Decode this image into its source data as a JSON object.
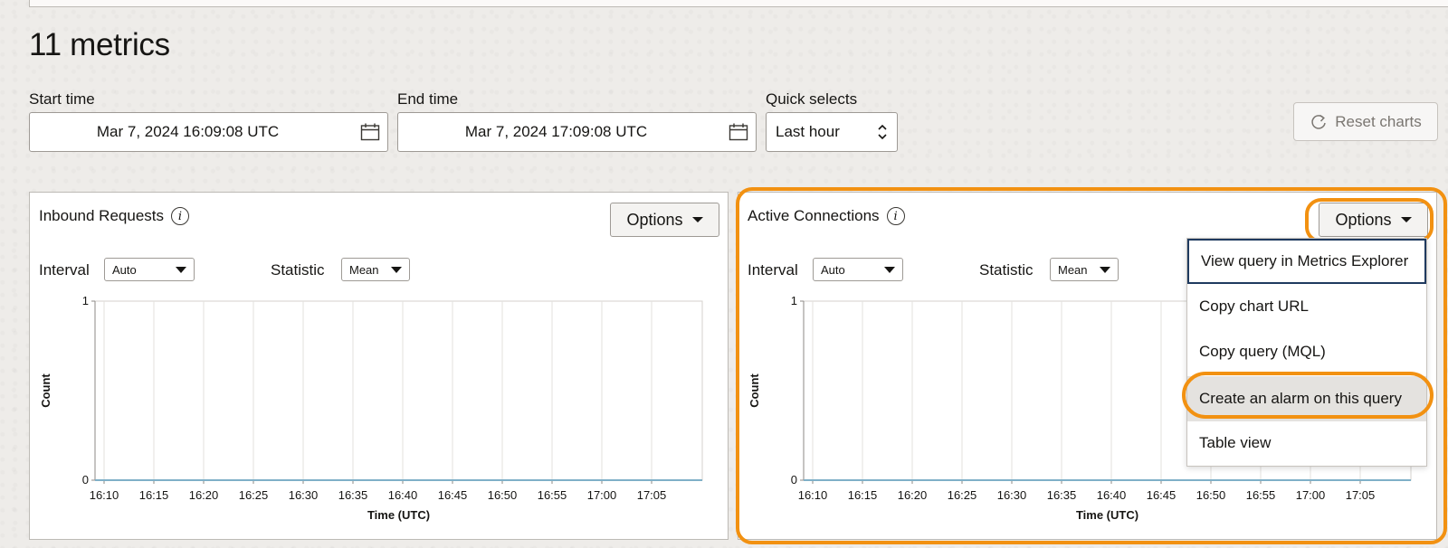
{
  "page": {
    "title": "11 metrics"
  },
  "filters": {
    "start_label": "Start time",
    "start_value": "Mar 7, 2024 16:09:08 UTC",
    "end_label": "End time",
    "end_value": "Mar 7, 2024 17:09:08 UTC",
    "quick_label": "Quick selects",
    "quick_value": "Last hour",
    "reset_label": "Reset charts"
  },
  "charts": [
    {
      "title": "Inbound Requests",
      "options_label": "Options",
      "interval_label": "Interval",
      "interval_value": "Auto",
      "statistic_label": "Statistic",
      "statistic_value": "Mean"
    },
    {
      "title": "Active Connections",
      "options_label": "Options",
      "interval_label": "Interval",
      "interval_value": "Auto",
      "statistic_label": "Statistic",
      "statistic_value": "Mean"
    }
  ],
  "options_menu": {
    "items": [
      "View query in Metrics Explorer",
      "Copy chart URL",
      "Copy query (MQL)",
      "Create an alarm on this query",
      "Table view"
    ]
  },
  "colors": {
    "highlight": "#f29111",
    "series_line": "#7fb0c8",
    "focus": "#1f3a5f"
  },
  "chart_data": [
    {
      "type": "line",
      "title": "Inbound Requests",
      "xlabel": "Time (UTC)",
      "ylabel": "Count",
      "x": [
        "16:10",
        "16:15",
        "16:20",
        "16:25",
        "16:30",
        "16:35",
        "16:40",
        "16:45",
        "16:50",
        "16:55",
        "17:00",
        "17:05"
      ],
      "ylim": [
        0,
        1
      ],
      "yticks": [
        "0",
        "1"
      ],
      "series": [
        {
          "values": [
            0,
            0,
            0,
            0,
            0,
            0,
            0,
            0,
            0,
            0,
            0,
            0
          ]
        }
      ],
      "grid": true
    },
    {
      "type": "line",
      "title": "Active Connections",
      "xlabel": "Time (UTC)",
      "ylabel": "Count",
      "x": [
        "16:10",
        "16:15",
        "16:20",
        "16:25",
        "16:30",
        "16:35",
        "16:40",
        "16:45",
        "16:50",
        "16:55",
        "17:00",
        "17:05"
      ],
      "ylim": [
        0,
        1
      ],
      "yticks": [
        "0",
        "1"
      ],
      "series": [
        {
          "values": [
            0,
            0,
            0,
            0,
            0,
            0,
            0,
            0,
            0,
            0,
            0,
            0
          ]
        }
      ],
      "grid": true
    }
  ]
}
